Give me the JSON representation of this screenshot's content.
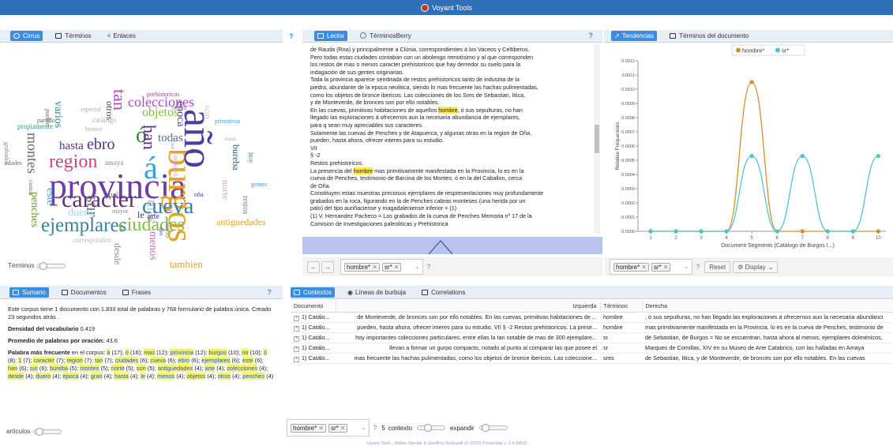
{
  "app": {
    "title": "Voyant Tools"
  },
  "cirrus": {
    "tabs": [
      {
        "label": "Cirrus"
      },
      {
        "label": "Términos"
      },
      {
        "label": "Enlaces"
      }
    ],
    "slider_label": "Términos",
    "words": [
      "provincia",
      "burgos",
      "ó",
      "á",
      "año",
      "mas",
      "caracter",
      "cueva",
      "region",
      "ejemplares",
      "ciudades",
      "ebro",
      "han",
      "sur",
      "colecciones",
      "tan",
      "epoca",
      "objetos",
      "todas",
      "son",
      "este",
      "hasta",
      "montes",
      "antiguedades",
      "tambien",
      "bureba",
      "norte",
      "restos",
      "penches",
      "duero",
      "desde",
      "menos",
      "varios",
      "otros",
      "arte",
      "le",
      "amaya",
      "mayor",
      "corresponden",
      "prehistoricos",
      "especial",
      "catálogo",
      "bronce",
      "partido",
      "propiamente",
      "primitivas",
      "edades",
      "gentes",
      "hoy",
      "estas",
      "orden",
      "oña",
      "actual",
      "romanos",
      "hierro",
      "dio",
      "gran",
      "cuenca",
      "pueblo",
      "grabados",
      "fué"
    ]
  },
  "reader": {
    "tabs": [
      {
        "label": "Lector"
      },
      {
        "label": "TérminosBerry"
      }
    ],
    "lines": [
      [
        "de Rauda (Roa) y principalmente a Clúnia, correspondientes á los Vaceos y Celtiberos.",
        "",
        ""
      ],
      [
        "Pero todas estas ciudades contaban con un abolengo remotísimo y al que corresponden",
        "",
        ""
      ],
      [
        "los restos de mas o menos caracter prehistoricos que hay derredor su suelo para la",
        "",
        ""
      ],
      [
        "indagación de sus gentes originarias.",
        "",
        ""
      ],
      [
        "Toda la provincia aparece sembrada de restos prehistoricos tanto de industria de la",
        "",
        ""
      ],
      [
        "piedra, abundante de la epoca neolitica, siendo lo mas frecuente las hachas pulimentadas,",
        "",
        ""
      ],
      [
        "como los objetos de bronce ibericos. Las colecciones de los Sres de Sebastian, litica,",
        "",
        ""
      ],
      [
        "y de Monteverde, de bronces son por ello notables.",
        "",
        ""
      ],
      [
        "En las cuevas, primitivas habitaciones de aquellos ",
        "hombre",
        ", ó sus sepulturas, no han"
      ],
      [
        "llegado las exploraciones á ofrecernos aun la necesaria abundancia de ejemplares,",
        "",
        ""
      ],
      [
        "para q sean muy apreciables sus caracteres.",
        "",
        ""
      ],
      [
        "Solamente las cuevas de Penches y de Atapuerca, y algunas otras en la region de Oña,",
        "",
        ""
      ],
      [
        "pueden, hasta ahora, ofrecer interes para su estudio.",
        "",
        ""
      ],
      [
        "VII",
        "",
        ""
      ],
      [
        "§ -2",
        "",
        ""
      ],
      [
        "Restos prehistoricos.",
        "",
        ""
      ],
      [
        "La presencia del ",
        "hombre",
        " mas primitivamente manifestada en la Provincia, lo es en la"
      ],
      [
        "cueva de Penches, testimonio de Barcina de los Montes, ó en la del Caballon, cerca",
        "",
        ""
      ],
      [
        "de Oña.",
        "",
        ""
      ],
      [
        "Constituyen estas muestras preciosos ejemplares de respresentaciones muy profundamente",
        "",
        ""
      ],
      [
        "grabados en la roca, figurando en la de Penches cabras monteses (una herida por un",
        "",
        ""
      ],
      [
        "palo) del tipo auriñaciense y magadaleniense inferior = (1)",
        "",
        ""
      ],
      [
        "(1) V. Hernandez Pacheco = Los grabados de la cueva de Penches Memoria nº 17 de la",
        "",
        ""
      ],
      [
        "Comision de Investigaciones paleoliticas y Prehistorica",
        "",
        ""
      ]
    ],
    "terms": [
      "hombre*",
      "sr*"
    ]
  },
  "trends": {
    "tabs": [
      {
        "label": "Tendencias"
      },
      {
        "label": "Términos del documento"
      }
    ],
    "reset_label": "Reset",
    "display_label": "Display",
    "terms": [
      "hombre*",
      "sr*"
    ]
  },
  "chart_data": {
    "type": "line",
    "x": [
      1,
      2,
      3,
      4,
      5,
      6,
      7,
      8,
      9,
      10
    ],
    "series": [
      {
        "name": "hombre*",
        "color": "#d0902a",
        "values": [
          0,
          0,
          0,
          0,
          0.00105,
          0,
          0,
          0,
          0,
          0
        ]
      },
      {
        "name": "sr*",
        "color": "#4cc5c7",
        "values": [
          0,
          0,
          0,
          0,
          0.00053,
          0,
          0.00053,
          0,
          0,
          0.00053
        ]
      }
    ],
    "xlabel": "Document Segments (Catálogo de Burgos I...)",
    "ylabel": "Relative Frequencies",
    "ylim": [
      0,
      0.0012
    ],
    "yticks": [
      "0.0000",
      "0.0001",
      "0.0002",
      "0.0003",
      "0.0004",
      "0.0005",
      "0.0006",
      "0.0007",
      "0.0008",
      "0.0009",
      "0.0010",
      "0.0011",
      "0.0012"
    ],
    "grid": false,
    "legend": "top-center"
  },
  "summary": {
    "tabs": [
      {
        "label": "Sumario"
      },
      {
        "label": "Documentos"
      },
      {
        "label": "Frases"
      }
    ],
    "intro": "Este corpus tiene 1 documento con 1,833 total de palabras y 768 formulario de palabra única. Creado 23 segundos atrás .",
    "density_label": "Densidad del vocabulario",
    "density_value": "0.419",
    "avg_label": "Promedio de palabras por oración:",
    "avg_value": "43.6",
    "freq_label": "Palabra más frecuente",
    "freq_suffix": " en el corpus: ",
    "freq_words": [
      [
        "á",
        " (17); "
      ],
      [
        "ó",
        " (16); "
      ],
      [
        "mas",
        " (12); "
      ],
      [
        "provincia",
        " (12); "
      ],
      [
        "burgos",
        " (10); "
      ],
      [
        "no",
        " (10); "
      ],
      [
        "ó",
        " (8); "
      ],
      [
        "1",
        " (7); "
      ],
      [
        "caracter",
        " (7); "
      ],
      [
        "region",
        " (7); "
      ],
      [
        "tan",
        " (7); "
      ],
      [
        "ciudades",
        " (6); "
      ],
      [
        "cueva",
        " (6); "
      ],
      [
        "ebro",
        " (6); "
      ],
      [
        "ejemplares",
        " (6); "
      ],
      [
        "este",
        " (6); "
      ],
      [
        "han",
        " (6); "
      ],
      [
        "sur",
        " (6); "
      ],
      [
        "bureba",
        " (5); "
      ],
      [
        "montes",
        " (5); "
      ],
      [
        "norte",
        " (5); "
      ],
      [
        "son",
        " (5); "
      ],
      [
        "antiguedades",
        " (4); "
      ],
      [
        "arte",
        " (4); "
      ],
      [
        "colecciones",
        " (4); "
      ],
      [
        "desde",
        " (4); "
      ],
      [
        "duero",
        " (4); "
      ],
      [
        "epoca",
        " (4); "
      ],
      [
        "gran",
        " (4); "
      ],
      [
        "hasta",
        " (4); "
      ],
      [
        "le",
        " (4); "
      ],
      [
        "menos",
        " (4); "
      ],
      [
        "objetos",
        " (4); "
      ],
      [
        "otros",
        " (4); "
      ],
      [
        "penches",
        " (4)"
      ]
    ],
    "slider_label": "artículos"
  },
  "contexts": {
    "tabs": [
      {
        "label": "Contextos"
      },
      {
        "label": "Líneas de burbuja"
      },
      {
        "label": "Correlations"
      }
    ],
    "columns": [
      "Documento",
      "Izquierda",
      "Términos",
      "Derecha"
    ],
    "rows": [
      [
        "1) Catálo...",
        "de Monteverde, de bronces son por ello notables. En las cuevas, primitivas habitaciones de ...",
        "hombre",
        ", ó sus sepulturas, no han llegado las exploraciones á ofrecernos aun la necesaria abundanci"
      ],
      [
        "1) Catálo...",
        "pueden, hasta ahora, ofrecer interes para su estudio. VII § -2 Restos prehistoricos. La prese...",
        "hombre",
        "mas primitivamente manifestada en la Provincia, lo es en la cueva de Penches, testimonio de"
      ],
      [
        "1) Catálo...",
        "hoy importantes colecciones particulares, entre ellas la tan notable de mas de 300 ejemplare...",
        "sr",
        "de Sebastian, de Burgos = No se encuentran, hasta ahora al menos, ejemplares dolménicos,"
      ],
      [
        "1) Catálo...",
        "llevan a formar un gurpo compacto, notado al punto al comparar las que posee el",
        "sr",
        "Marques de Comillas, XIV en su Museo de Arte Catabrico, con las halladas en Amaya"
      ],
      [
        "1) Catálo...",
        "mas frecuente las hachas pulimentadas, como los objetos de bronce ibericos. Las coleccione...",
        "sres",
        "de Sebastian, litica, y de Monteverde, de bronces son por ello notables. En las cuevas"
      ]
    ],
    "terms": [
      "hombre*",
      "sr*"
    ],
    "context_value": "5",
    "context_label": "contexto",
    "expand_label": "expandir"
  },
  "footer": {
    "text": "Voyant Tools , Stéfan Sinclair & Geoffrey Rockwell (© 2020) Privacidad v. 2.4 (M52)"
  }
}
